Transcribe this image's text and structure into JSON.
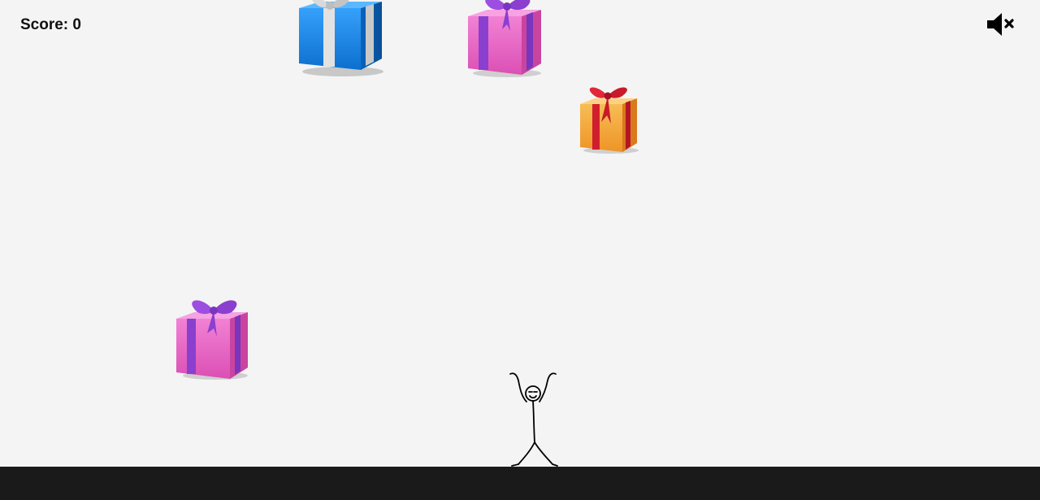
{
  "hud": {
    "score_label": "Score:",
    "score_value": "0",
    "sound_state": "muted",
    "sound_icon": "speaker-muted-icon"
  },
  "gifts": [
    {
      "name": "gift-blue",
      "box_color": "#1a8fe3",
      "ribbon_color": "#d8d8d8"
    },
    {
      "name": "gift-pink",
      "box_color": "#e35fc0",
      "ribbon_color": "#8b3fd0"
    },
    {
      "name": "gift-orange",
      "box_color": "#f0a030",
      "ribbon_color": "#d41f2f"
    },
    {
      "name": "gift-pink",
      "box_color": "#e35fc0",
      "ribbon_color": "#8b3fd0"
    }
  ],
  "player": {
    "icon": "stick-figure-icon"
  },
  "colors": {
    "background": "#f4f4f4",
    "ground": "#1b1a1b",
    "text": "#111111"
  }
}
